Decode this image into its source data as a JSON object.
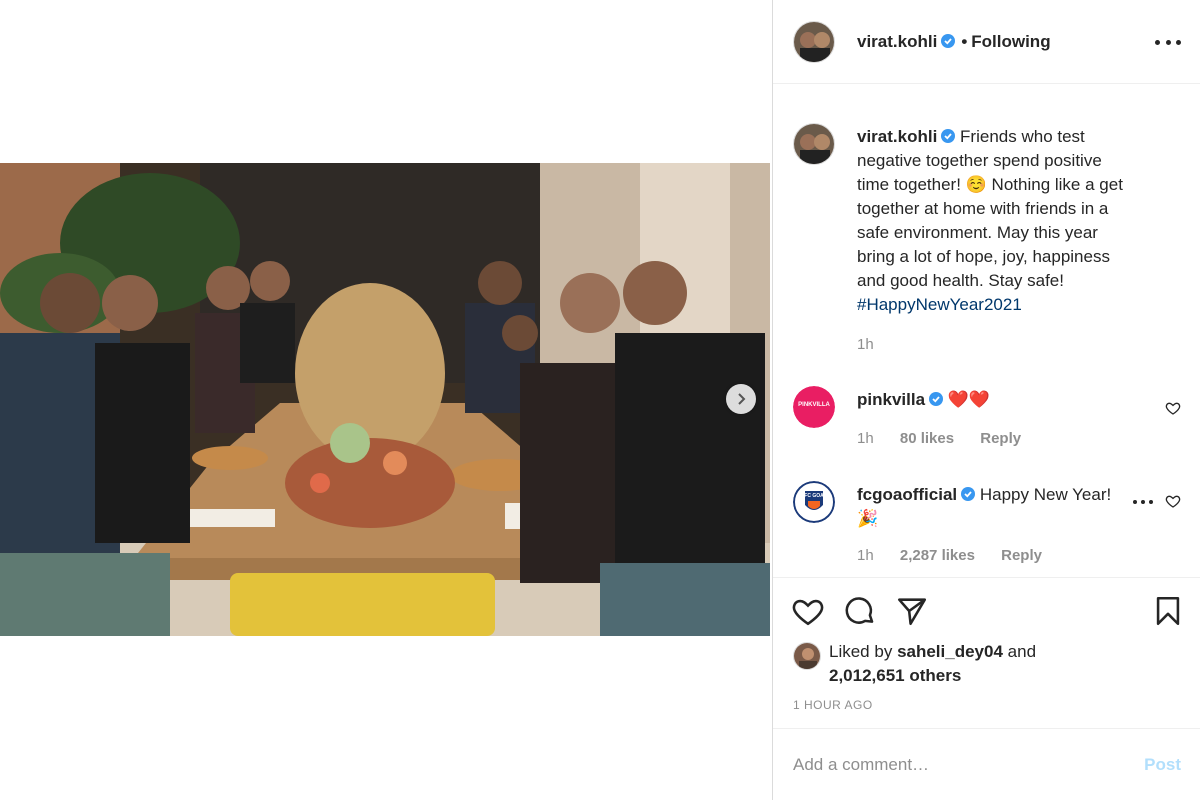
{
  "post": {
    "author": "virat.kohli",
    "following_separator": "•",
    "following_label": "Following",
    "caption_text": "Friends who test negative together spend positive time together! ☺️ Nothing like a get together at home with friends in a safe environment. May this year bring a lot of hope, joy, happiness and good health. Stay safe!",
    "caption_hashtag": "#HappyNewYear2021",
    "caption_age": "1h"
  },
  "comments": [
    {
      "username": "pinkvilla",
      "avatar_text": "PINKVILLA",
      "text": "❤️❤️",
      "age": "1h",
      "likes": "80 likes",
      "reply_label": "Reply"
    },
    {
      "username": "fcgoaofficial",
      "avatar_text": "FC GOA",
      "text": "Happy New Year! 🎉",
      "age": "1h",
      "likes": "2,287 likes",
      "reply_label": "Reply"
    }
  ],
  "likes": {
    "prefix": "Liked by",
    "user": "saheli_dey04",
    "conjunction": "and",
    "others": "2,012,651 others"
  },
  "timestamp": "1 HOUR AGO",
  "comment_box": {
    "placeholder": "Add a comment…",
    "post_label": "Post"
  },
  "icons": {
    "verified": "verified-badge-icon",
    "like": "heart-icon",
    "comment": "comment-bubble-icon",
    "share": "paper-plane-icon",
    "save": "bookmark-icon",
    "next": "chevron-right-icon",
    "more": "more-options-icon"
  },
  "colors": {
    "verified": "#3897f0",
    "hashtag": "#00376b",
    "muted": "#8e8e8e",
    "post_disabled": "#b2dffc",
    "heart": "#e0245e",
    "pinkvilla": "#e91e63"
  }
}
